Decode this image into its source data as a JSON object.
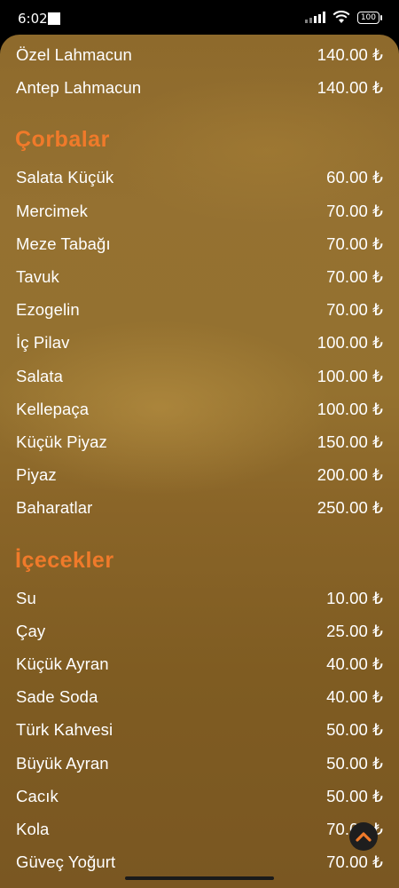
{
  "status_bar": {
    "time": "6:02",
    "battery": "100"
  },
  "menu": {
    "top_items": [
      {
        "name": "Özel Lahmacun",
        "price": "140.00 ₺"
      },
      {
        "name": "Antep Lahmacun",
        "price": "140.00 ₺"
      }
    ],
    "sections": [
      {
        "title": "Çorbalar",
        "items": [
          {
            "name": "Salata Küçük",
            "price": "60.00 ₺"
          },
          {
            "name": "Mercimek",
            "price": "70.00 ₺"
          },
          {
            "name": "Meze Tabağı",
            "price": "70.00 ₺"
          },
          {
            "name": "Tavuk",
            "price": "70.00 ₺"
          },
          {
            "name": "Ezogelin",
            "price": "70.00 ₺"
          },
          {
            "name": "İç Pilav",
            "price": "100.00 ₺"
          },
          {
            "name": "Salata",
            "price": "100.00 ₺"
          },
          {
            "name": "Kellepaça",
            "price": "100.00 ₺"
          },
          {
            "name": "Küçük Piyaz",
            "price": "150.00 ₺"
          },
          {
            "name": "Piyaz",
            "price": "200.00 ₺"
          },
          {
            "name": "Baharatlar",
            "price": "250.00 ₺"
          }
        ]
      },
      {
        "title": "İçecekler",
        "items": [
          {
            "name": "Su",
            "price": "10.00 ₺"
          },
          {
            "name": "Çay",
            "price": "25.00 ₺"
          },
          {
            "name": "Küçük Ayran",
            "price": "40.00 ₺"
          },
          {
            "name": "Sade Soda",
            "price": "40.00 ₺"
          },
          {
            "name": "Türk Kahvesi",
            "price": "50.00 ₺"
          },
          {
            "name": "Büyük Ayran",
            "price": "50.00 ₺"
          },
          {
            "name": "Cacık",
            "price": "50.00 ₺"
          },
          {
            "name": "Kola",
            "price": "70.00 ₺"
          },
          {
            "name": "Güveç Yoğurt",
            "price": "70.00 ₺"
          }
        ]
      }
    ]
  },
  "colors": {
    "section_title": "#f07a2a",
    "scroll_button_arrow": "#f07a2a"
  },
  "icons": {
    "scroll_top": "chevron-up-icon"
  }
}
